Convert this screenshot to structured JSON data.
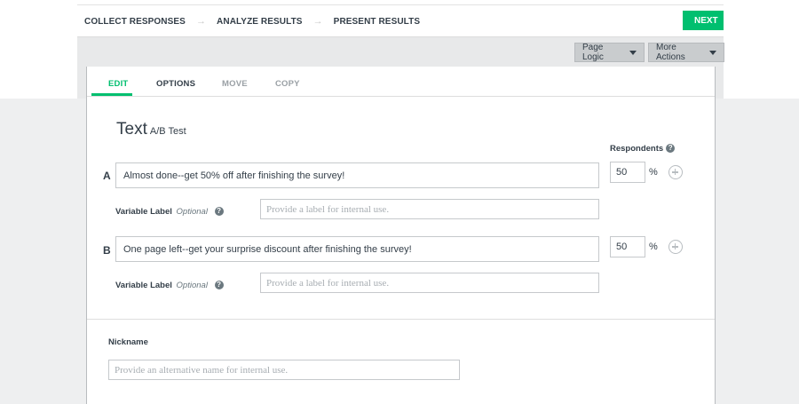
{
  "steps": [
    {
      "label": "COLLECT RESPONSES"
    },
    {
      "label": "ANALYZE RESULTS"
    },
    {
      "label": "PRESENT RESULTS"
    }
  ],
  "next_label": "NEXT",
  "actions": {
    "page_logic": "Page Logic",
    "more_actions": "More Actions"
  },
  "tabs": [
    {
      "label": "EDIT",
      "active": true
    },
    {
      "label": "OPTIONS",
      "active": false
    },
    {
      "label": "MOVE",
      "active": false
    },
    {
      "label": "COPY",
      "active": false
    }
  ],
  "question": {
    "title": "Text",
    "subtitle": "A/B Test"
  },
  "respondents_label": "Respondents",
  "variable_label": {
    "text": "Variable Label",
    "optional": "Optional"
  },
  "label_placeholder": "Provide a label for internal use.",
  "variants": [
    {
      "letter": "A",
      "text": "Almost done--get 50% off after finishing the survey!",
      "percent": "50"
    },
    {
      "letter": "B",
      "text": "One page left--get your surprise discount after finishing the survey!",
      "percent": "50"
    }
  ],
  "percent_sign": "%",
  "help_glyph": "?",
  "nickname": {
    "label": "Nickname",
    "placeholder": "Provide an alternative name for internal use."
  },
  "colors": {
    "accent": "#00bf6f",
    "text": "#333e48"
  }
}
